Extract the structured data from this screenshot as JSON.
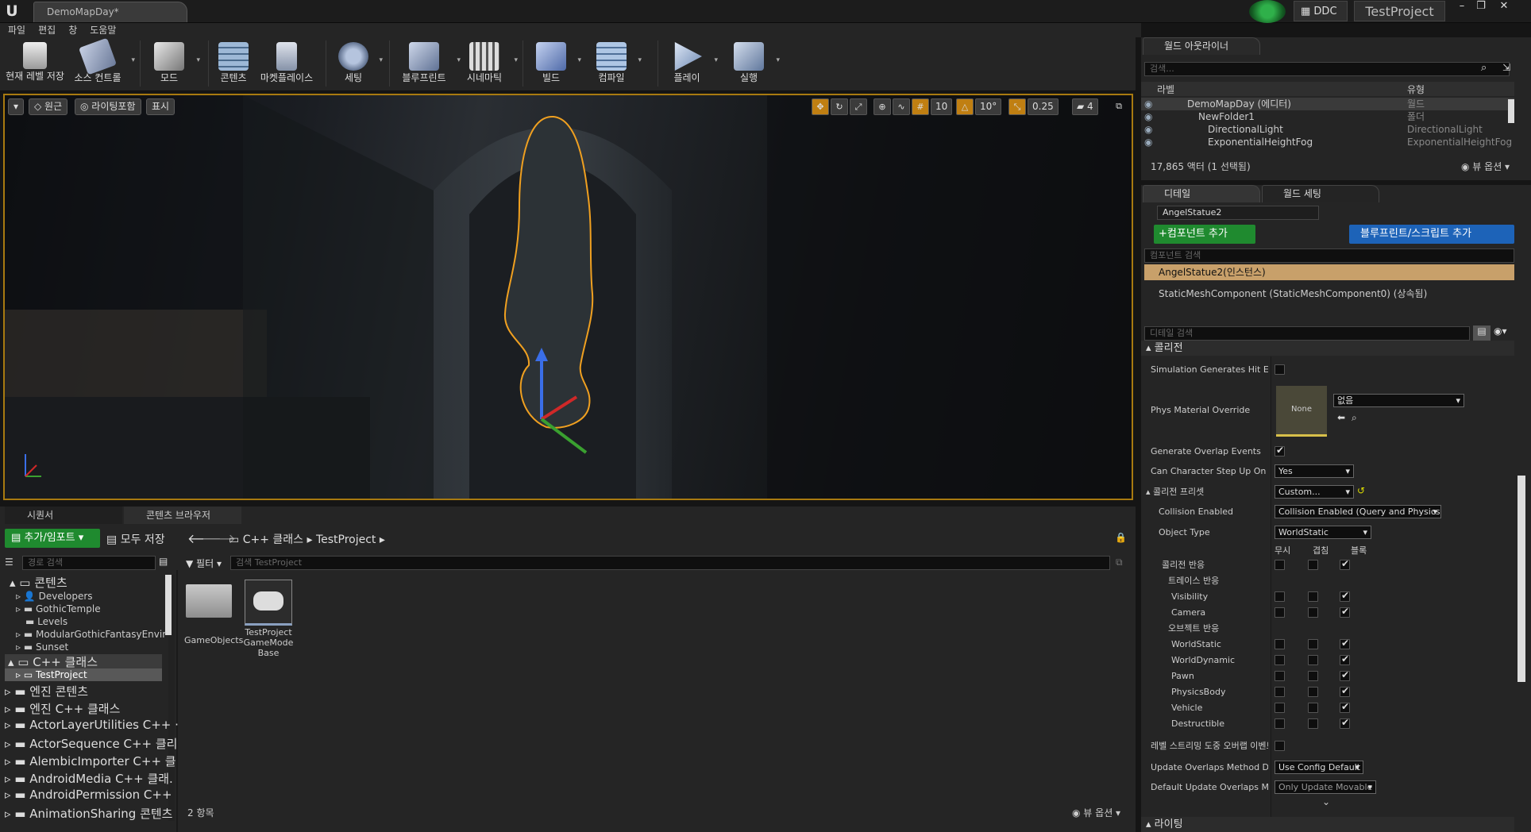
{
  "window": {
    "doc_tab": "DemoMapDay*",
    "ddc_label": "DDC",
    "project_button": "TestProject",
    "min": "–",
    "max": "❐",
    "close": "✕"
  },
  "menu": [
    "파일",
    "편집",
    "창",
    "도움말"
  ],
  "toolbar": {
    "items": [
      {
        "label": "현재 레벨 저장",
        "icon": "save-icon",
        "color": "#d9d9d9"
      },
      {
        "label": "소스 컨트롤",
        "icon": "source-control-icon",
        "color": "#9aa9c7"
      },
      {
        "label": "모드",
        "icon": "modes-icon",
        "color": "#cfcfcf"
      },
      {
        "label": "콘텐츠",
        "icon": "content-icon",
        "color": "#9db8d6"
      },
      {
        "label": "마켓플레이스",
        "icon": "marketplace-icon",
        "color": "#b9c3d6"
      },
      {
        "label": "세팅",
        "icon": "settings-icon",
        "color": "#8fa3c5"
      },
      {
        "label": "블루프린트",
        "icon": "blueprint-icon",
        "color": "#98a9c8"
      },
      {
        "label": "시네마틱",
        "icon": "cinematics-icon",
        "color": "#b3b3b3"
      },
      {
        "label": "빌드",
        "icon": "build-icon",
        "color": "#9eb4e0"
      },
      {
        "label": "컴파일",
        "icon": "compile-icon",
        "color": "#8fb0d6"
      },
      {
        "label": "플레이",
        "icon": "play-icon",
        "color": "#b8c8e0"
      },
      {
        "label": "실행",
        "icon": "launch-icon",
        "color": "#a4b8d6"
      }
    ]
  },
  "viewport": {
    "btn_perspective": "원근",
    "btn_lighting": "라이팅포함",
    "btn_show": "표시",
    "grid_snap": "10",
    "rot_snap": "10°",
    "scale_snap": "0.25",
    "cam_speed": "4"
  },
  "outliner": {
    "tab": "월드 아웃라이너",
    "search_placeholder": "검색...",
    "col_label": "라벨",
    "col_type": "유형",
    "rows": [
      {
        "label": "DemoMapDay (에디터)",
        "type": "월드"
      },
      {
        "label": "NewFolder1",
        "type": "폴더"
      },
      {
        "label": "DirectionalLight",
        "type": "DirectionalLight"
      },
      {
        "label": "ExponentialHeightFog",
        "type": "ExponentialHeightFog"
      }
    ],
    "status": "17,865 액터 (1 선택됨)",
    "view_options": "뷰 옵션"
  },
  "details": {
    "tab_details": "디테일",
    "tab_world": "월드 세팅",
    "actor_name": "AngelStatue2",
    "btn_add_component": "+컴포넌트 추가",
    "btn_add_blueprint": "블루프린트/스크립트 추가",
    "component_search_placeholder": "컴포넌트 검색",
    "instance_row": "AngelStatue2(인스턴스)",
    "component_row": "StaticMeshComponent (StaticMeshComponent0) (상속됨)",
    "details_search_placeholder": "디테일 검색",
    "section_collision": "콜리전",
    "props": {
      "sim_hit": "Simulation Generates Hit Eve",
      "phys_mat": "Phys Material Override",
      "phys_mat_thumb": "None",
      "phys_mat_value": "없음",
      "gen_overlap": "Generate Overlap Events",
      "can_step": "Can Character Step Up On",
      "can_step_value": "Yes",
      "preset": "콜리전 프리셋",
      "preset_value": "Custom...",
      "coll_enabled": "Collision Enabled",
      "coll_enabled_value": "Collision Enabled (Query and Physics)",
      "object_type": "Object Type",
      "object_type_value": "WorldStatic",
      "col_ignore": "무시",
      "col_overlap": "겹침",
      "col_block": "블록",
      "coll_response": "콜리전 반응",
      "trace_response": "트레이스 반응",
      "visibility": "Visibility",
      "camera": "Camera",
      "object_response": "오브젝트 반응",
      "world_static": "WorldStatic",
      "world_dynamic": "WorldDynamic",
      "pawn": "Pawn",
      "physics_body": "PhysicsBody",
      "vehicle": "Vehicle",
      "destructible": "Destructible",
      "level_streaming": "레벨 스트리밍 도중 오버랩 이벤트",
      "update_method": "Update Overlaps Method Duri",
      "update_method_value": "Use Config Default",
      "default_update": "Default Update Overlaps Metl",
      "default_update_value": "Only Update Movable",
      "lighting": "라이팅"
    }
  },
  "bottom": {
    "tab_sequencer": "시퀀서",
    "tab_content": "콘텐츠 브라우저",
    "btn_add_import": "추가/임포트",
    "btn_save_all": "모두 저장",
    "crumb_1": "C++ 클래스",
    "crumb_2": "TestProject",
    "path_search_placeholder": "경로 검색",
    "filters": "필터",
    "search_placeholder": "검색 TestProject",
    "tree": {
      "content": "콘텐츠",
      "sub": [
        "Developers",
        "GothicTemple",
        "Levels",
        "ModularGothicFantasyEnvir",
        "Sunset"
      ],
      "cpp": "C++ 클래스",
      "cpp_sub": "TestProject",
      "rest": [
        "엔진 콘텐츠",
        "엔진 C++ 클래스",
        "ActorLayerUtilities C++ ·",
        "ActorSequence C++ 클리",
        "AlembicImporter C++ 클",
        "AndroidMedia C++ 클래.",
        "AndroidPermission C++",
        "AnimationSharing 콘텐츠"
      ]
    },
    "assets": [
      {
        "label": "GameObjects"
      },
      {
        "label": "TestProject GameMode Base"
      }
    ],
    "item_count": "2 항목",
    "view_options": "뷰 옵션"
  }
}
